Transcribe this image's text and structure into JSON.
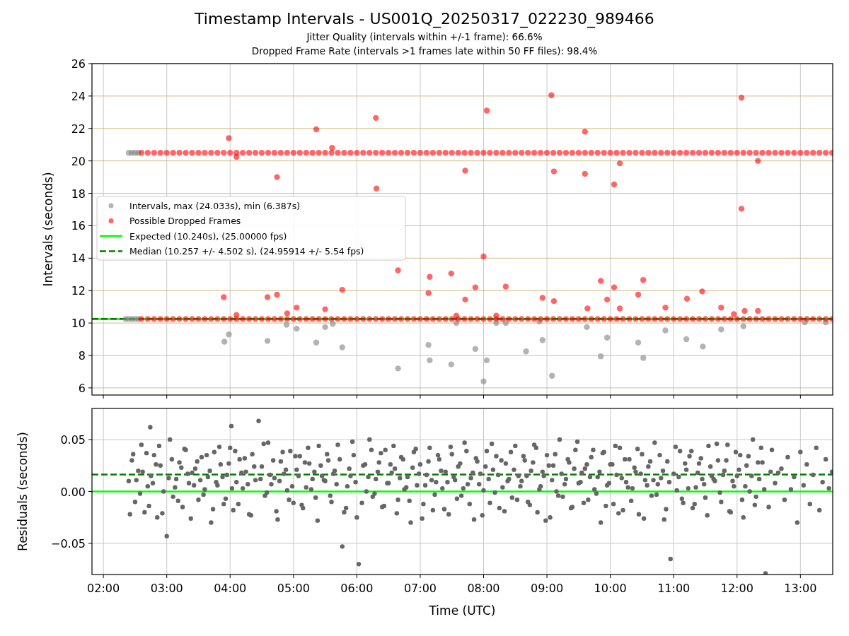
{
  "figure": {
    "title": "Timestamp Intervals - US001Q_20250317_022230_989466",
    "subtitles": [
      "Jitter Quality (intervals within +/-1 frame): 66.6%",
      "Dropped Frame Rate (intervals >1 frames late within 50 FF files): 98.4%"
    ]
  },
  "charts": [
    {
      "chart_data": {
        "type": "scatter",
        "ylabel": "Intervals (seconds)",
        "xlim": [
          1.82,
          13.51
        ],
        "ylim": [
          5.56,
          26
        ],
        "yticks": [
          {
            "value": 6,
            "label": "6"
          },
          {
            "value": 8,
            "label": "8"
          },
          {
            "value": 10,
            "label": "10"
          },
          {
            "value": 12,
            "label": "12"
          },
          {
            "value": 14,
            "label": "14"
          },
          {
            "value": 16,
            "label": "16"
          },
          {
            "value": 18,
            "label": "18"
          },
          {
            "value": 20,
            "label": "20"
          },
          {
            "value": 22,
            "label": "22"
          },
          {
            "value": 24,
            "label": "24"
          },
          {
            "value": 26,
            "label": "26"
          }
        ],
        "legend": true,
        "grid": true,
        "ref_lines": [
          {
            "axis": "y",
            "label": "Expected (10.240s), (25.00000 fps)",
            "value": 10.24,
            "color": "#00ff00"
          },
          {
            "axis": "y",
            "label": "Median (10.257 +/- 4.502 s), (24.95914 +/- 5.54 fps)",
            "value": 10.257,
            "color": "#007f00"
          }
        ],
        "series": [
          {
            "name": "Intervals, max (24.033s), min (6.387s)",
            "color": "#808080",
            "x": [
              2.4,
              2.45,
              2.5,
              2.55,
              2.35,
              2.4,
              2.45,
              2.5,
              2.55,
              3.91,
              3.98,
              4.59,
              4.89,
              5.05,
              5.36,
              5.5,
              5.77,
              5.62,
              6.65,
              7.13,
              7.15,
              7.49,
              7.57,
              7.87,
              8.0,
              8.05,
              8.2,
              8.35,
              8.67,
              8.93,
              8.88,
              9.08,
              9.63,
              9.85,
              9.95,
              10.44,
              10.52,
              10.87,
              11.2,
              11.46,
              11.75,
              12.1,
              13.07,
              13.4
            ],
            "values": [
              20.5,
              20.5,
              20.5,
              20.5,
              10.25,
              10.25,
              10.25,
              10.25,
              10.25,
              8.85,
              9.3,
              8.9,
              9.9,
              9.65,
              8.8,
              9.75,
              8.5,
              9.95,
              7.2,
              8.65,
              7.7,
              7.45,
              10.0,
              8.4,
              6.4,
              7.7,
              10.0,
              10.0,
              8.25,
              8.95,
              10.1,
              6.75,
              9.75,
              7.95,
              9.1,
              8.8,
              7.85,
              9.55,
              9.0,
              8.55,
              9.6,
              9.8,
              10.05,
              10.05
            ]
          },
          {
            "name": "Possible Dropped Frames",
            "color": "#ff0000",
            "x": [
              2.6,
              2.7,
              2.8,
              2.9,
              3.0,
              3.1,
              3.2,
              3.3,
              3.4,
              3.5,
              3.6,
              3.7,
              3.8,
              3.9,
              4.0,
              4.1,
              4.2,
              4.3,
              4.4,
              4.5,
              4.6,
              4.7,
              4.8,
              4.9,
              5.0,
              5.1,
              5.2,
              5.3,
              5.4,
              5.5,
              5.6,
              5.7,
              5.8,
              5.9,
              6.0,
              6.1,
              6.2,
              6.3,
              6.4,
              6.5,
              6.6,
              6.7,
              6.8,
              6.9,
              7.0,
              7.1,
              7.2,
              7.3,
              7.4,
              7.5,
              7.6,
              7.7,
              7.8,
              7.9,
              8.0,
              8.1,
              8.2,
              8.3,
              8.4,
              8.5,
              8.6,
              8.7,
              8.8,
              8.9,
              9.0,
              9.1,
              9.2,
              9.3,
              9.4,
              9.5,
              9.6,
              9.7,
              9.8,
              9.9,
              10.0,
              10.1,
              10.2,
              10.3,
              10.4,
              10.5,
              10.6,
              10.7,
              10.8,
              10.9,
              11.0,
              11.1,
              11.2,
              11.3,
              11.4,
              11.5,
              11.6,
              11.7,
              11.8,
              11.9,
              12.0,
              12.1,
              12.2,
              12.3,
              12.4,
              12.5,
              12.6,
              12.7,
              12.8,
              12.9,
              13.0,
              13.1,
              13.2,
              13.3,
              13.4,
              13.5,
              2.6,
              2.7,
              2.8,
              2.9,
              3.0,
              3.1,
              3.2,
              3.3,
              3.4,
              3.5,
              3.6,
              3.7,
              3.8,
              3.9,
              4.0,
              4.1,
              4.2,
              4.3,
              4.4,
              4.5,
              4.6,
              4.7,
              4.8,
              4.9,
              5.0,
              5.1,
              5.2,
              5.3,
              5.4,
              5.5,
              5.6,
              5.7,
              5.8,
              5.9,
              6.0,
              6.1,
              6.2,
              6.3,
              6.4,
              6.5,
              6.6,
              6.7,
              6.8,
              6.9,
              7.0,
              7.1,
              7.2,
              7.3,
              7.4,
              7.5,
              7.6,
              7.7,
              7.8,
              7.9,
              8.0,
              8.1,
              8.2,
              8.3,
              8.4,
              8.5,
              8.6,
              8.7,
              8.8,
              8.9,
              9.0,
              9.1,
              9.2,
              9.3,
              9.4,
              9.5,
              9.6,
              9.7,
              9.8,
              9.9,
              10.0,
              10.1,
              10.2,
              10.3,
              10.4,
              10.5,
              10.6,
              10.7,
              10.8,
              10.9,
              11.0,
              11.1,
              11.2,
              11.3,
              11.4,
              11.5,
              11.6,
              11.7,
              11.8,
              11.9,
              12.0,
              12.1,
              12.2,
              12.3,
              12.4,
              12.5,
              12.6,
              12.7,
              12.8,
              12.9,
              13.0,
              13.1,
              13.2,
              13.3,
              13.4,
              13.5,
              3.9,
              3.98,
              4.1,
              4.1,
              4.59,
              4.74,
              4.74,
              4.9,
              5.05,
              5.36,
              5.5,
              5.61,
              5.77,
              6.3,
              6.31,
              6.65,
              7.13,
              7.15,
              7.49,
              7.57,
              7.71,
              7.71,
              7.87,
              8.0,
              8.05,
              8.2,
              8.35,
              8.93,
              9.07,
              9.11,
              9.11,
              9.6,
              9.6,
              9.64,
              9.85,
              9.95,
              10.06,
              10.06,
              10.15,
              10.15,
              10.44,
              10.52,
              10.87,
              11.21,
              11.45,
              11.75,
              11.95,
              12.07,
              12.07,
              12.12,
              12.33,
              12.33
            ],
            "values": [
              20.5,
              20.5,
              20.5,
              20.5,
              20.5,
              20.5,
              20.5,
              20.5,
              20.5,
              20.5,
              20.5,
              20.5,
              20.5,
              20.5,
              20.5,
              20.5,
              20.5,
              20.5,
              20.5,
              20.5,
              20.5,
              20.5,
              20.5,
              20.5,
              20.5,
              20.5,
              20.5,
              20.5,
              20.5,
              20.5,
              20.5,
              20.5,
              20.5,
              20.5,
              20.5,
              20.5,
              20.5,
              20.5,
              20.5,
              20.5,
              20.5,
              20.5,
              20.5,
              20.5,
              20.5,
              20.5,
              20.5,
              20.5,
              20.5,
              20.5,
              20.5,
              20.5,
              20.5,
              20.5,
              20.5,
              20.5,
              20.5,
              20.5,
              20.5,
              20.5,
              20.5,
              20.5,
              20.5,
              20.5,
              20.5,
              20.5,
              20.5,
              20.5,
              20.5,
              20.5,
              20.5,
              20.5,
              20.5,
              20.5,
              20.5,
              20.5,
              20.5,
              20.5,
              20.5,
              20.5,
              20.5,
              20.5,
              20.5,
              20.5,
              20.5,
              20.5,
              20.5,
              20.5,
              20.5,
              20.5,
              20.5,
              20.5,
              20.5,
              20.5,
              20.5,
              20.5,
              20.5,
              20.5,
              20.5,
              20.5,
              20.5,
              20.5,
              20.5,
              20.5,
              20.5,
              20.5,
              20.5,
              20.5,
              20.5,
              20.5,
              10.25,
              10.25,
              10.25,
              10.25,
              10.25,
              10.25,
              10.25,
              10.25,
              10.25,
              10.25,
              10.25,
              10.25,
              10.25,
              10.25,
              10.25,
              10.25,
              10.25,
              10.25,
              10.25,
              10.25,
              10.25,
              10.25,
              10.25,
              10.25,
              10.25,
              10.25,
              10.25,
              10.25,
              10.25,
              10.25,
              10.25,
              10.25,
              10.25,
              10.25,
              10.25,
              10.25,
              10.25,
              10.25,
              10.25,
              10.25,
              10.25,
              10.25,
              10.25,
              10.25,
              10.25,
              10.25,
              10.25,
              10.25,
              10.25,
              10.25,
              10.25,
              10.25,
              10.25,
              10.25,
              10.25,
              10.25,
              10.25,
              10.25,
              10.25,
              10.25,
              10.25,
              10.25,
              10.25,
              10.25,
              10.25,
              10.25,
              10.25,
              10.25,
              10.25,
              10.25,
              10.25,
              10.25,
              10.25,
              10.25,
              10.25,
              10.25,
              10.25,
              10.25,
              10.25,
              10.25,
              10.25,
              10.25,
              10.25,
              10.25,
              10.25,
              10.25,
              10.25,
              10.25,
              10.25,
              10.25,
              10.25,
              10.25,
              10.25,
              10.25,
              10.25,
              10.25,
              10.25,
              10.25,
              10.25,
              10.25,
              10.25,
              10.25,
              10.25,
              10.25,
              10.25,
              10.25,
              10.25,
              10.25,
              10.25,
              10.25,
              11.6,
              21.4,
              20.25,
              10.5,
              11.6,
              19.0,
              11.75,
              10.6,
              10.95,
              21.95,
              10.85,
              20.8,
              12.05,
              22.65,
              18.3,
              13.25,
              11.85,
              12.85,
              13.05,
              10.45,
              11.45,
              19.4,
              12.2,
              14.1,
              23.1,
              10.45,
              12.25,
              11.55,
              24.05,
              19.35,
              11.35,
              21.8,
              19.2,
              10.9,
              12.6,
              11.45,
              18.55,
              12.2,
              19.85,
              10.9,
              11.75,
              12.65,
              10.95,
              11.5,
              11.95,
              10.95,
              10.55,
              17.05,
              23.9,
              10.75,
              20.0,
              10.75
            ]
          }
        ]
      }
    },
    {
      "chart_data": {
        "type": "scatter",
        "xlabel": "Time (UTC)",
        "ylabel": "Residuals (seconds)",
        "xlim": [
          1.82,
          13.51
        ],
        "ylim": [
          -0.08,
          0.08
        ],
        "xticks": [
          {
            "value": 2,
            "label": "02:00"
          },
          {
            "value": 3,
            "label": "03:00"
          },
          {
            "value": 4,
            "label": "04:00"
          },
          {
            "value": 5,
            "label": "05:00"
          },
          {
            "value": 6,
            "label": "06:00"
          },
          {
            "value": 7,
            "label": "07:00"
          },
          {
            "value": 8,
            "label": "08:00"
          },
          {
            "value": 9,
            "label": "09:00"
          },
          {
            "value": 10,
            "label": "10:00"
          },
          {
            "value": 11,
            "label": "11:00"
          },
          {
            "value": 12,
            "label": "12:00"
          },
          {
            "value": 13,
            "label": "13:00"
          }
        ],
        "yticks": [
          {
            "value": -0.05,
            "label": "−0.05"
          },
          {
            "value": 0,
            "label": "0.00"
          },
          {
            "value": 0.05,
            "label": "0.05"
          }
        ],
        "legend": false,
        "grid": true,
        "ref_lines": [
          {
            "axis": "y",
            "value": 0,
            "color": "#00ff00"
          },
          {
            "axis": "y",
            "value": 0.0163,
            "color": "#007f00"
          }
        ],
        "series": [
          {
            "color": "#666666",
            "x": [
              2.4,
              2.45,
              2.5,
              2.55,
              2.6,
              2.65,
              2.7,
              2.75,
              2.8,
              2.85,
              2.9,
              2.95,
              3.05,
              3.1,
              3.15,
              3.2,
              3.25,
              3.3,
              3.35,
              3.4,
              3.45,
              3.5,
              3.55,
              3.6,
              3.65,
              3.7,
              3.75,
              3.8,
              3.85,
              3.9,
              3.95,
              4.0,
              4.05,
              4.1,
              4.15,
              4.2,
              4.25,
              4.3,
              4.35,
              4.4,
              4.5,
              4.55,
              4.6,
              4.65,
              4.7,
              4.75,
              4.8,
              4.85,
              4.9,
              4.95,
              5.0,
              5.05,
              5.1,
              5.15,
              5.2,
              5.25,
              5.3,
              5.35,
              5.4,
              5.45,
              5.5,
              5.55,
              5.6,
              5.65,
              5.7,
              5.8,
              5.85,
              5.9,
              5.95,
              6.0,
              6.1,
              6.15,
              6.2,
              6.25,
              6.3,
              6.35,
              6.4,
              6.45,
              6.5,
              6.55,
              6.6,
              6.65,
              6.7,
              6.75,
              6.8,
              6.85,
              6.9,
              6.95,
              7.0,
              7.05,
              7.1,
              7.15,
              7.2,
              7.25,
              7.3,
              7.35,
              7.4,
              7.45,
              7.5,
              7.55,
              7.6,
              7.65,
              7.7,
              7.75,
              7.8,
              7.85,
              7.9,
              7.95,
              8.0,
              8.05,
              8.1,
              8.15,
              8.2,
              8.25,
              8.3,
              8.35,
              8.4,
              8.45,
              8.5,
              8.55,
              8.6,
              8.65,
              8.7,
              8.75,
              8.8,
              8.85,
              8.9,
              8.95,
              9.0,
              9.05,
              9.1,
              9.15,
              9.2,
              9.25,
              9.3,
              9.35,
              9.4,
              9.45,
              9.5,
              9.55,
              9.6,
              9.65,
              9.7,
              9.75,
              9.8,
              9.85,
              9.9,
              9.95,
              10.0,
              10.05,
              10.1,
              10.15,
              10.2,
              10.25,
              10.3,
              10.35,
              10.4,
              10.45,
              10.5,
              10.55,
              10.6,
              10.65,
              10.7,
              10.75,
              10.8,
              10.85,
              10.9,
              11.0,
              11.05,
              11.1,
              11.15,
              11.2,
              11.25,
              11.3,
              11.35,
              11.4,
              11.45,
              11.5,
              11.55,
              11.6,
              11.65,
              11.7,
              11.75,
              11.8,
              11.85,
              11.9,
              11.95,
              12.0,
              12.05,
              12.1,
              12.15,
              12.2,
              12.25,
              12.3,
              12.35,
              12.4,
              12.5,
              12.55,
              12.6,
              12.65,
              12.7,
              12.75,
              12.8,
              12.85,
              12.9,
              12.95,
              13.0,
              13.05,
              13.1,
              13.15,
              13.2,
              13.25,
              13.3,
              13.35,
              13.4,
              13.45,
              13.5,
              2.42,
              2.47,
              2.52,
              2.58,
              2.62,
              2.68,
              2.72,
              2.78,
              2.83,
              2.88,
              2.93,
              3.03,
              3.08,
              3.13,
              3.18,
              3.23,
              3.28,
              3.33,
              3.38,
              3.43,
              3.48,
              3.53,
              3.58,
              3.63,
              3.68,
              3.73,
              3.78,
              3.83,
              3.88,
              3.93,
              3.98,
              4.03,
              4.08,
              4.13,
              4.18,
              4.23,
              4.28,
              4.33,
              4.38,
              4.48,
              4.53,
              4.58,
              4.63,
              4.68,
              4.73,
              4.78,
              4.83,
              4.88,
              4.93,
              4.98,
              5.03,
              5.08,
              5.13,
              5.18,
              5.23,
              5.28,
              5.33,
              5.38,
              5.43,
              5.48,
              5.53,
              5.58,
              5.63,
              5.68,
              5.73,
              5.83,
              5.88,
              5.93,
              5.98,
              6.08,
              6.13,
              6.18,
              6.23,
              6.28,
              6.33,
              6.38,
              6.43,
              6.48,
              6.53,
              6.58,
              6.63,
              6.68,
              6.73,
              6.78,
              6.83,
              6.88,
              6.93,
              6.98,
              7.03,
              7.08,
              7.13,
              7.18,
              7.23,
              7.28,
              7.33,
              7.38,
              7.43,
              7.48,
              7.53,
              7.58,
              7.63,
              7.68,
              7.73,
              7.78,
              7.83,
              7.88,
              7.93,
              7.98,
              8.03,
              8.08,
              8.13,
              8.18,
              8.23,
              8.28,
              8.33,
              8.38,
              8.43,
              8.48,
              8.53,
              8.58,
              8.63,
              8.68,
              8.73,
              8.78,
              8.83,
              8.88,
              8.93,
              8.98,
              9.03,
              9.08,
              9.13,
              9.18,
              9.23,
              9.28,
              9.33,
              9.38,
              9.43,
              9.48,
              9.53,
              9.58,
              9.63,
              9.68,
              9.73,
              9.78,
              9.83,
              9.88,
              9.93,
              9.98,
              10.03,
              10.08,
              10.13,
              10.18,
              10.23,
              10.28,
              10.33,
              10.38,
              10.43,
              10.48,
              10.53,
              10.58,
              10.63,
              10.68,
              10.73,
              10.78,
              10.83,
              10.88,
              10.93,
              11.03,
              11.08,
              11.13,
              11.18,
              11.23,
              11.28,
              11.33,
              11.38,
              11.43,
              11.48,
              11.53,
              11.58,
              11.63,
              11.68,
              11.73,
              11.78,
              11.83,
              11.88,
              11.93,
              11.98,
              12.03,
              12.08,
              12.13,
              12.18,
              12.23,
              12.28,
              12.33,
              12.38,
              12.43,
              12.53,
              4.45,
              6.03,
              10.95,
              12.45,
              3.0,
              5.77,
              4.02,
              2.74
            ],
            "values": [
              0.01,
              0.03,
              -0.01,
              0.02,
              0.045,
              -0.02,
              0.005,
              0.015,
              0.035,
              -0.025,
              0.025,
              0.0,
              0.05,
              -0.005,
              0.012,
              0.028,
              -0.015,
              0.04,
              0.008,
              0.018,
              0.022,
              -0.008,
              0.033,
              0.002,
              0.014,
              -0.03,
              0.038,
              0.006,
              0.026,
              -0.012,
              0.016,
              0.042,
              -0.018,
              0.009,
              0.031,
              0.003,
              0.019,
              -0.022,
              0.036,
              0.011,
              0.024,
              -0.004,
              0.047,
              0.007,
              0.013,
              -0.027,
              0.029,
              0.017,
              0.001,
              0.039,
              -0.011,
              0.021,
              0.034,
              -0.016,
              0.004,
              0.027,
              0.012,
              -0.006,
              0.044,
              0.015,
              0.01,
              0.03,
              -0.01,
              0.02,
              0.045,
              -0.02,
              0.005,
              0.015,
              0.035,
              -0.025,
              0.025,
              0.0,
              0.05,
              -0.005,
              0.012,
              0.028,
              -0.015,
              0.04,
              0.008,
              0.018,
              0.022,
              -0.008,
              0.033,
              0.002,
              0.014,
              -0.03,
              0.038,
              0.006,
              0.026,
              -0.012,
              0.016,
              0.042,
              -0.018,
              0.009,
              0.031,
              0.003,
              0.019,
              -0.022,
              0.036,
              0.011,
              0.024,
              -0.004,
              0.047,
              0.007,
              0.013,
              -0.027,
              0.029,
              0.017,
              0.001,
              0.039,
              -0.011,
              0.021,
              0.034,
              -0.016,
              0.004,
              0.027,
              0.012,
              -0.006,
              0.044,
              0.015,
              0.01,
              0.03,
              -0.01,
              0.02,
              0.045,
              -0.02,
              0.005,
              0.015,
              0.035,
              -0.025,
              0.025,
              0.0,
              0.05,
              -0.005,
              0.012,
              0.028,
              -0.015,
              0.04,
              0.008,
              0.018,
              0.022,
              -0.008,
              0.033,
              0.002,
              0.014,
              -0.03,
              0.038,
              0.006,
              0.026,
              -0.012,
              0.016,
              0.042,
              -0.018,
              0.009,
              0.031,
              0.003,
              0.019,
              -0.022,
              0.036,
              0.011,
              0.024,
              -0.004,
              0.047,
              0.007,
              0.013,
              -0.027,
              0.029,
              0.017,
              0.001,
              0.039,
              -0.011,
              0.021,
              0.034,
              -0.016,
              0.004,
              0.027,
              0.012,
              -0.006,
              0.044,
              0.015,
              0.01,
              0.03,
              -0.01,
              0.02,
              0.045,
              -0.02,
              0.005,
              0.015,
              0.035,
              -0.025,
              0.025,
              0.0,
              0.05,
              -0.005,
              0.012,
              0.028,
              -0.015,
              0.04,
              0.008,
              0.018,
              0.022,
              -0.008,
              0.033,
              0.002,
              0.014,
              -0.03,
              0.038,
              0.006,
              0.026,
              -0.012,
              0.016,
              0.042,
              -0.018,
              0.009,
              0.031,
              0.003,
              0.019,
              -0.022,
              0.036,
              0.011,
              -0.002,
              0.019,
              0.037,
              -0.014,
              0.008,
              0.026,
              0.044,
              -0.021,
              0.013,
              0.031,
              0.004,
              -0.009,
              0.023,
              0.041,
              0.017,
              -0.026,
              0.006,
              0.029,
              0.011,
              -0.003,
              0.035,
              0.02,
              -0.017,
              0.009,
              0.043,
              0.014,
              -0.007,
              0.027,
              0.003,
              0.039,
              -0.012,
              0.018,
              0.032,
              0.007,
              -0.023,
              0.024,
              0.012,
              0.046,
              -0.001,
              0.016,
              0.03,
              -0.019,
              0.01,
              0.038,
              0.021,
              -0.008,
              0.005,
              0.034,
              0.015,
              -0.013,
              0.028,
              0.042,
              0.002,
              0.019,
              -0.028,
              0.025,
              0.011,
              0.036,
              -0.004,
              0.017,
              0.007,
              0.031,
              -0.016,
              0.022,
              0.048,
              0.009,
              -0.011,
              0.026,
              0.014,
              0.04,
              -0.002,
              0.019,
              0.037,
              -0.014,
              0.008,
              0.026,
              0.044,
              -0.021,
              0.013,
              0.031,
              0.004,
              -0.009,
              0.023,
              0.041,
              0.017,
              -0.026,
              0.006,
              0.029,
              0.011,
              -0.003,
              0.035,
              0.02,
              -0.017,
              0.009,
              0.043,
              0.014,
              -0.007,
              0.027,
              0.003,
              0.039,
              -0.012,
              0.018,
              0.032,
              0.007,
              -0.023,
              0.024,
              0.012,
              0.046,
              -0.001,
              0.016,
              0.03,
              -0.019,
              0.01,
              0.038,
              0.021,
              -0.008,
              0.005,
              0.034,
              0.015,
              -0.013,
              0.028,
              0.042,
              0.002,
              0.019,
              -0.028,
              0.025,
              0.011,
              0.036,
              -0.004,
              0.017,
              0.007,
              0.031,
              -0.016,
              0.022,
              0.048,
              0.009,
              -0.011,
              0.026,
              0.014,
              0.04,
              -0.002,
              0.019,
              0.037,
              -0.014,
              0.008,
              0.026,
              0.044,
              -0.021,
              0.013,
              0.031,
              0.004,
              -0.009,
              0.023,
              0.041,
              0.017,
              -0.026,
              0.006,
              0.029,
              0.011,
              -0.003,
              0.035,
              0.02,
              -0.017,
              0.009,
              0.043,
              0.014,
              -0.007,
              0.027,
              0.003,
              0.039,
              -0.012,
              0.018,
              0.032,
              0.007,
              -0.023,
              0.024,
              0.012,
              0.046,
              -0.001,
              0.016,
              0.03,
              -0.019,
              0.01,
              0.038,
              0.021,
              -0.008,
              0.005,
              0.034,
              0.015,
              -0.013,
              0.028,
              0.042,
              0.002,
              0.019,
              0.068,
              -0.07,
              -0.065,
              -0.079,
              -0.043,
              -0.053,
              0.063,
              0.062
            ]
          }
        ]
      }
    }
  ]
}
